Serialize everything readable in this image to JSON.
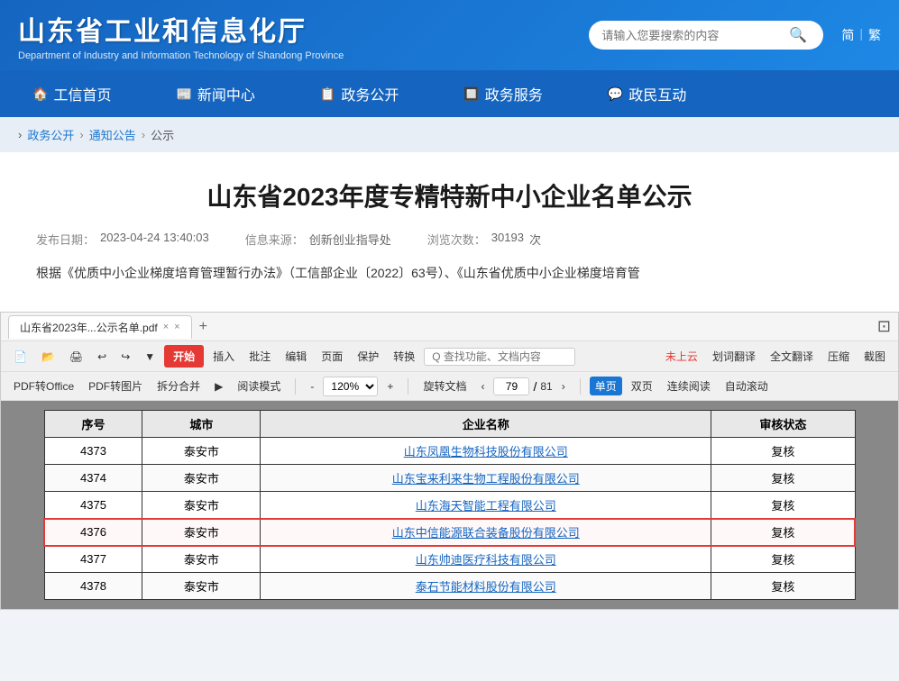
{
  "header": {
    "logo_title": "山东省工业和信息化厅",
    "logo_subtitle": "Department of Industry and Information Technology of Shandong Province",
    "search_placeholder": "请输入您要搜索的内容",
    "lang_simple": "简",
    "lang_traditional": "繁"
  },
  "nav": {
    "items": [
      {
        "label": "工信首页",
        "icon": "🏠"
      },
      {
        "label": "新闻中心",
        "icon": "📰"
      },
      {
        "label": "政务公开",
        "icon": "📋"
      },
      {
        "label": "政务服务",
        "icon": "🔲"
      },
      {
        "label": "政民互动",
        "icon": "💬"
      }
    ]
  },
  "breadcrumb": {
    "items": [
      "政务公开",
      "通知公告",
      "公示"
    ]
  },
  "article": {
    "title": "山东省2023年度专精特新中小企业名单公示",
    "publish_label": "发布日期：",
    "publish_date": "2023-04-24 13:40:03",
    "source_label": "信息来源：",
    "source": "创新创业指导处",
    "views_label": "浏览次数：",
    "views": "30193",
    "views_unit": "次",
    "intro": "根据《优质中小企业梯度培育管理暂行办法》（工信部企业〔2022〕63号）、《山东省优质中小企业梯度培育管"
  },
  "pdf": {
    "tab_label": "山东省2023年...公示名单.pdf",
    "tab_close": "×",
    "tab_add": "+",
    "toolbar": {
      "btn_start": "开始",
      "btn_insert": "插入",
      "btn_annotate": "批注",
      "btn_edit": "编辑",
      "btn_page": "页面",
      "btn_protect": "保护",
      "btn_convert": "转换",
      "search_placeholder": "Q 查找功能、文档内容",
      "btn_not_uploaded": "未上云",
      "btn_word_translate": "划词翻译",
      "btn_full_translate": "全文翻译",
      "btn_compress": "压缩",
      "btn_screenshot": "截图"
    },
    "toolbar2": {
      "btn_pdf_to_office": "PDF转Office",
      "btn_pdf_to_img": "PDF转图片",
      "btn_split_merge": "拆分合并",
      "btn_play": "▶",
      "btn_read_mode": "阅读模式",
      "zoom": "120%",
      "btn_zoom_out": "-",
      "btn_zoom_in": "+",
      "btn_rotate": "旋转文档",
      "current_page": "79",
      "total_pages": "81",
      "btn_prev": "‹",
      "btn_next": "›",
      "btn_single": "单页",
      "btn_double": "双页",
      "btn_continuous": "连续阅读",
      "btn_auto_scroll": "自动滚动"
    },
    "table": {
      "header": [
        "序号",
        "城市",
        "企业名称",
        "审核状态"
      ],
      "rows": [
        {
          "id": "4373",
          "city": "泰安市",
          "company": "山东凤凰生物科技股份有限公司",
          "status": "复核",
          "highlighted": false
        },
        {
          "id": "4374",
          "city": "泰安市",
          "company": "山东宝来利来生物工程股份有限公司",
          "status": "复核",
          "highlighted": false
        },
        {
          "id": "4375",
          "city": "泰安市",
          "company": "山东海天智能工程有限公司",
          "status": "复核",
          "highlighted": false
        },
        {
          "id": "4376",
          "city": "泰安市",
          "company": "山东中信能源联合装备股份有限公司",
          "status": "复核",
          "highlighted": true
        },
        {
          "id": "4377",
          "city": "泰安市",
          "company": "山东帅迪医疗科技有限公司",
          "status": "复核",
          "highlighted": false
        },
        {
          "id": "4378",
          "city": "泰安市",
          "company": "泰石节能材料股份有限公司",
          "status": "复核",
          "highlighted": false
        }
      ]
    }
  }
}
